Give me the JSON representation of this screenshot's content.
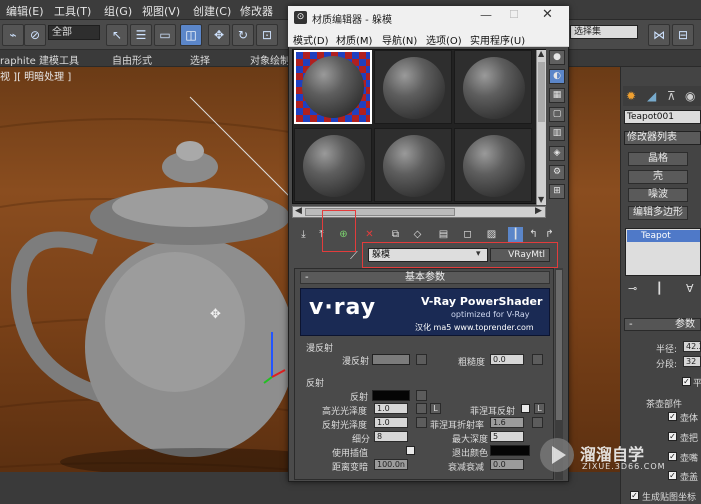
{
  "menubar": {
    "items": [
      "编辑(E)",
      "工具(T)",
      "组(G)",
      "视图(V)",
      "创建(C)",
      "修改器"
    ]
  },
  "toolbar": {
    "filter_value": "全部",
    "right_select_value": "选择集",
    "right_snippet": "“"
  },
  "ribbon": {
    "app_label": "raphite 建模工具",
    "tabs": [
      "自由形式",
      "选择",
      "对象绘制"
    ],
    "left_btn": "建"
  },
  "viewport": {
    "label": "视 ][ 明暗处理 ]"
  },
  "material_editor": {
    "title": "材质编辑器 - 躲模",
    "menu": [
      "模式(D)",
      "材质(M)",
      "导航(N)",
      "选项(O)",
      "实用程序(U)"
    ],
    "material_name": "躲模",
    "material_type": "VRayMtl",
    "basic_params_title": "基本参数",
    "banner": {
      "logo": "v·ray",
      "product": "V-Ray PowerShader",
      "tagline": "optimized for V-Ray",
      "credit": "汉化 ma5 www.toprender.com"
    },
    "diffuse": {
      "group": "漫反射",
      "label": "漫反射",
      "roughness_label": "粗糙度",
      "roughness_value": "0.0"
    },
    "reflection": {
      "group": "反射",
      "label": "反射",
      "hilight_gloss_label": "高光光泽度",
      "hilight_gloss_value": "1.0",
      "lock_btn": "L",
      "fresnel_label": "菲涅耳反射",
      "refl_gloss_label": "反射光泽度",
      "refl_gloss_value": "1.0",
      "fresnel_ior_label": "菲涅耳折射率",
      "fresnel_ior_value": "1.6",
      "subdivs_label": "细分",
      "subdivs_value": "8",
      "max_depth_label": "最大深度",
      "max_depth_value": "5",
      "interp_label": "使用插值",
      "exit_color_label": "退出颜色",
      "dim_dist_label": "距离变暗",
      "dim_dist_value": "100.0n",
      "dim_falloff_label": "衰减衰减",
      "dim_falloff_value": "0.0"
    }
  },
  "command_panel": {
    "object_name": "Teapot001",
    "modifier_list": "修改器列表",
    "buttons": [
      "晶格",
      "壳",
      "噪波",
      "编辑多边形"
    ],
    "stack_item": "Teapot",
    "params_title": "参数",
    "radius_label": "半径:",
    "radius_value": "42.2",
    "segments_label": "分段:",
    "segments_value": "32",
    "smooth_label": "平",
    "parts_label": "茶壶部件",
    "parts": [
      "壶体",
      "壶把",
      "壶嘴",
      "壶盖"
    ],
    "gen_coords": "生成贴图坐标"
  },
  "watermark": {
    "cn": "溜溜自学",
    "url": "ZIXUE.3D66.COM"
  },
  "colors": {
    "accent_red": "#e23c3c",
    "selection_blue": "#5b86c9"
  }
}
